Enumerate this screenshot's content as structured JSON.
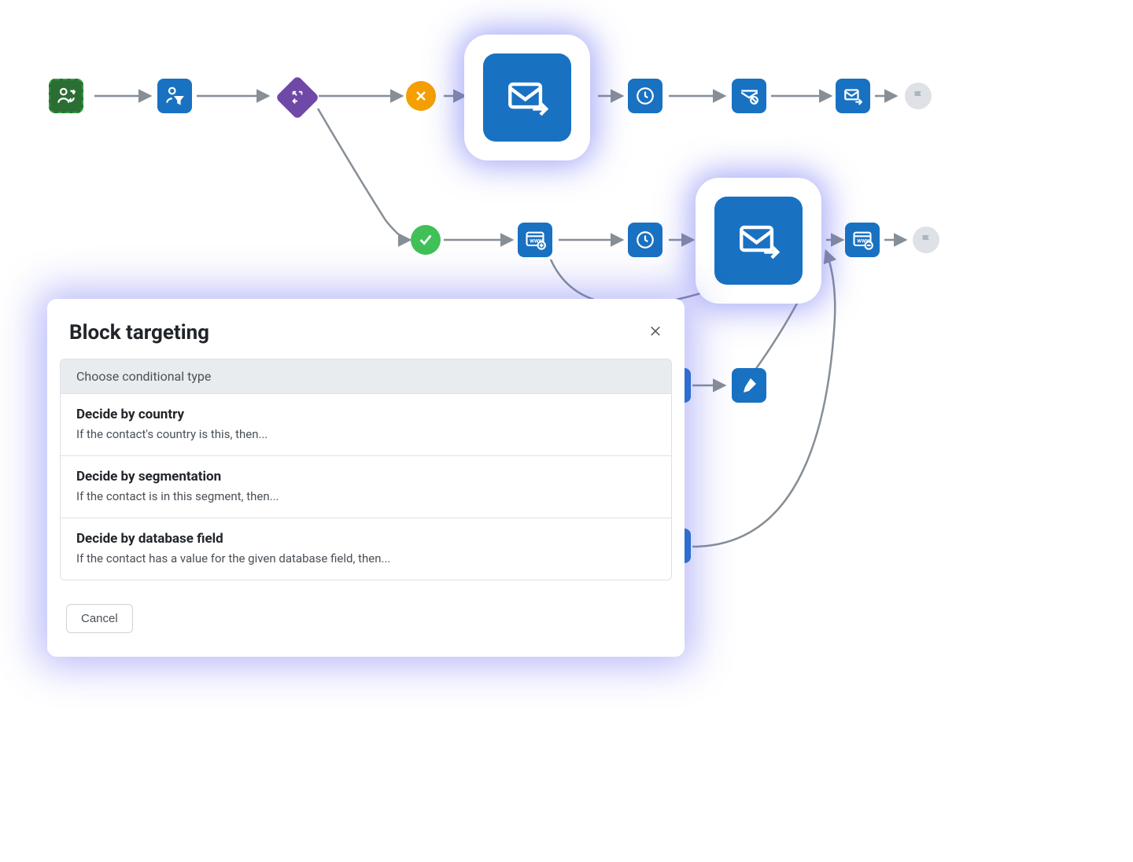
{
  "modal": {
    "title": "Block targeting",
    "group_header": "Choose conditional type",
    "options": [
      {
        "title": "Decide by country",
        "desc": "If the contact's country is this, then..."
      },
      {
        "title": "Decide by segmentation",
        "desc": "If the contact is in this segment, then..."
      },
      {
        "title": "Decide by database field",
        "desc": "If the contact has a value for the given database field, then..."
      }
    ],
    "cancel": "Cancel"
  },
  "nodes": {
    "start": "contact-sync",
    "filter": "contact-filter",
    "decision": "decision-split",
    "cross": "x-badge",
    "check": "check-badge",
    "email_big_1": "email-send-large",
    "email_big_2": "email-send-large",
    "wait1": "wait-clock",
    "wait2": "wait-clock",
    "email_cancel": "email-cancel",
    "email_send_small": "email-send",
    "www_add": "www-add",
    "www_remove": "www-remove",
    "pen": "edit-tag",
    "end": "flag-end"
  }
}
